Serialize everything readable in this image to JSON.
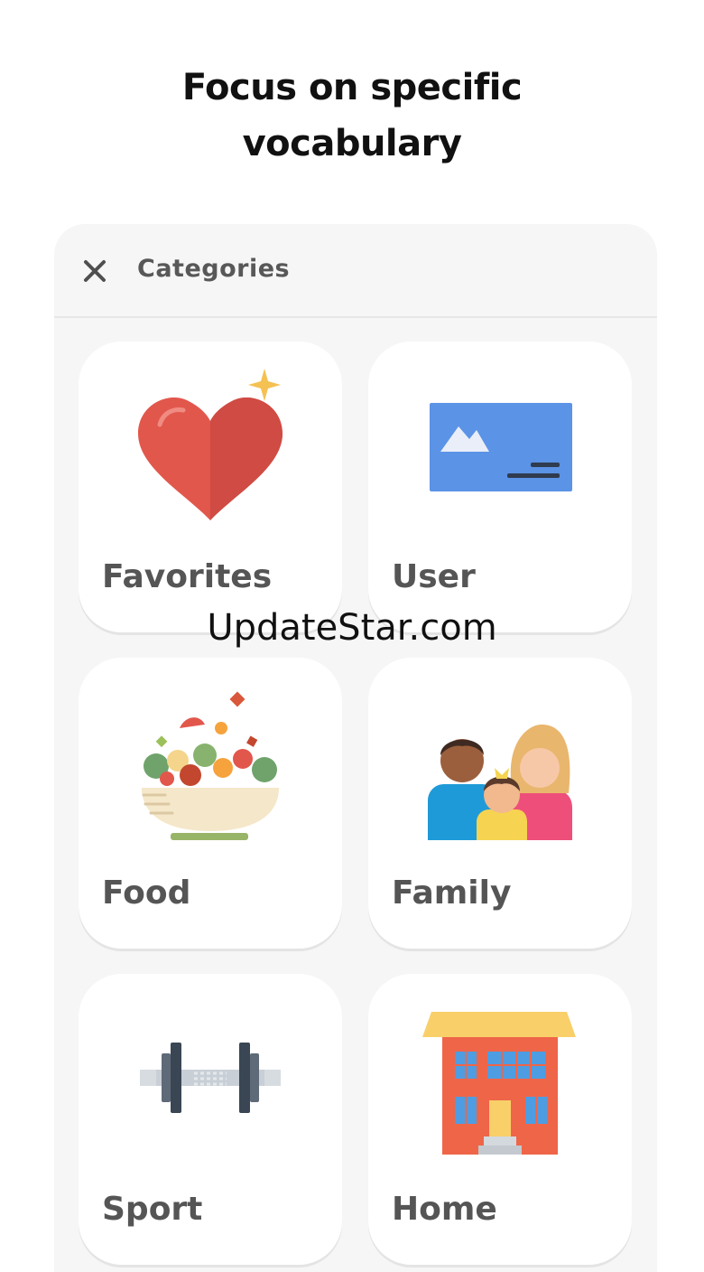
{
  "headline": {
    "line1": "Focus on specific",
    "line2": "vocabulary"
  },
  "panel": {
    "title": "Categories",
    "close_icon": "close-icon"
  },
  "categories": [
    {
      "label": "Favorites",
      "icon": "heart-icon"
    },
    {
      "label": "User",
      "icon": "image-card-icon"
    },
    {
      "label": "Food",
      "icon": "salad-bowl-icon"
    },
    {
      "label": "Family",
      "icon": "family-icon"
    },
    {
      "label": "Sport",
      "icon": "dumbbell-icon"
    },
    {
      "label": "Home",
      "icon": "house-icon"
    }
  ],
  "watermark": "UpdateStar.com",
  "colors": {
    "background": "#ffffff",
    "panel": "#f6f6f6",
    "card": "#ffffff",
    "label": "#555555",
    "heart": "#e2574c",
    "user_card": "#5b93e6"
  }
}
